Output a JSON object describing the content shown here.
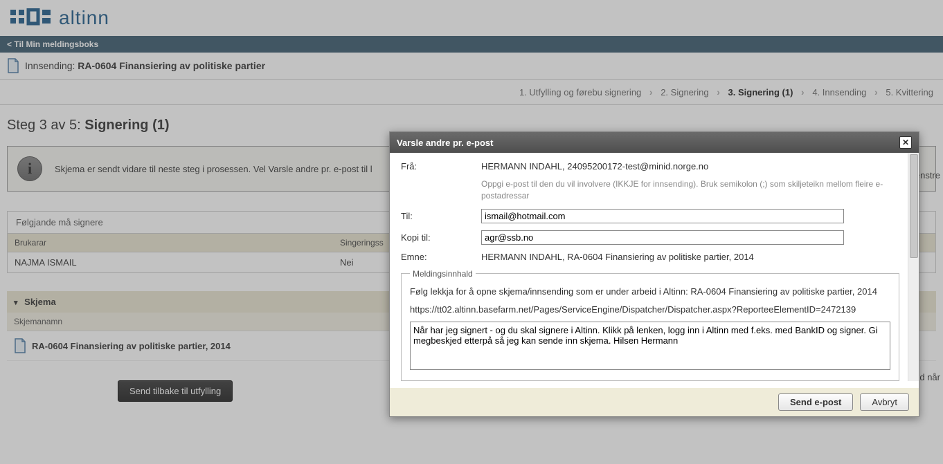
{
  "logo_text": "altinn",
  "breadcrumb": "< Til Min meldingsboks",
  "innsending_prefix": "Innsending: ",
  "innsending_title": "RA-0604 Finansiering av politiske partier",
  "steps": {
    "s1": "1. Utfylling og førebu signering",
    "s2": "2. Signering",
    "s3": "3. Signering (1)",
    "s4": "4. Innsending",
    "s5": "5. Kvittering"
  },
  "step_header_pre": "Steg 3 av 5: ",
  "step_header_main": "Signering (1)",
  "info_text": "Skjema er sendt vidare til neste steg i prosessen. Vel Varsle andre pr. e-post til l",
  "sign_caption": "Følgjande må signere",
  "sign_cols": {
    "c1": "Brukarar",
    "c2": "Singeringss"
  },
  "sign_row": {
    "user": "NAJMA ISMAIL",
    "status": "Nei"
  },
  "skjema_label": "Skjema",
  "skjemanamn_label": "Skjemanamn",
  "skjema_row": "RA-0604 Finansiering av politiske partier, 2014",
  "btn_back": "Send tilbake til utfylling",
  "side_text_1": "enstre",
  "side_text_2": "d når",
  "modal": {
    "title": "Varsle andre pr. e-post",
    "from_label": "Frå:",
    "from_value": "HERMANN INDAHL, 24095200172-test@minid.norge.no",
    "helper": "Oppgi e-post til den du vil involvere (IKKJE for innsending). Bruk semikolon (;) som skiljeteikn mellom fleire e-postadressar",
    "to_label": "Til:",
    "to_value": "ismail@hotmail.com",
    "cc_label": "Kopi til:",
    "cc_value": "agr@ssb.no",
    "subject_label": "Emne:",
    "subject_value": "HERMANN INDAHL, RA-0604 Finansiering av politiske partier, 2014",
    "legend": "Meldingsinnhald",
    "body_line1": "Følg lekkja for å opne skjema/innsending som er under arbeid i Altinn: RA-0604 Finansiering av politiske partier, 2014",
    "body_line2": "https://tt02.altinn.basefarm.net/Pages/ServiceEngine/Dispatcher/Dispatcher.aspx?ReporteeElementID=2472139",
    "body_textarea": "Når har jeg signert - og du skal signere i Altinn. Klikk på lenken, logg inn i Altinn med f.eks. med BankID og signer. Gi megbeskjed etterpå så jeg kan sende inn skjema. Hilsen Hermann",
    "btn_send": "Send e-post",
    "btn_cancel": "Avbryt"
  }
}
